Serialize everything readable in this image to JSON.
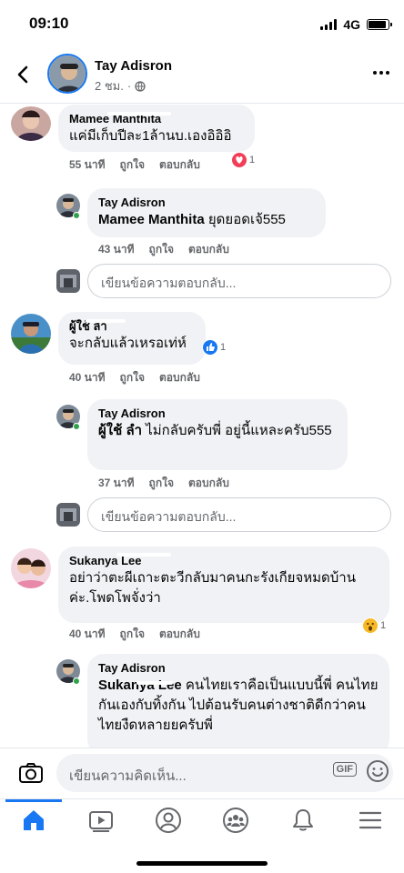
{
  "status_bar": {
    "time": "09:10",
    "network": "4G"
  },
  "header": {
    "name": "Tay Adisron",
    "time": "2 ชม."
  },
  "comments": [
    {
      "author": "Mamee Manthita",
      "text": "แค่มีเก็บปีละ1ล้านบ.เองอิอิอิ",
      "time": "55 นาที",
      "like": "ถูกใจ",
      "reply": "ตอบกลับ",
      "reaction": {
        "type": "love",
        "count": "1"
      },
      "replies": [
        {
          "author": "Tay Adisron",
          "tag": "Mamee Manthita",
          "text": "ยุดยอดเจ้555",
          "time": "43 นาที",
          "like": "ถูกใจ",
          "reply": "ตอบกลับ"
        }
      ],
      "reply_placeholder": "เขียนข้อความตอบกลับ..."
    },
    {
      "author": "ผู้ใช้ ลำ",
      "text": "จะกลับแล้วเหรอเท่ห์",
      "time": "40 นาที",
      "like": "ถูกใจ",
      "reply": "ตอบกลับ",
      "reaction": {
        "type": "like",
        "count": "1"
      },
      "replies": [
        {
          "author": "Tay Adisron",
          "tag": "ผู้ใช้ ลำ",
          "text": "ไม่กลับครับพี่ อยู่นี้แหละครับ555",
          "time": "37 นาที",
          "like": "ถูกใจ",
          "reply": "ตอบกลับ"
        }
      ],
      "reply_placeholder": "เขียนข้อความตอบกลับ..."
    },
    {
      "author": "Sukanya Lee",
      "text": "อย่าว่าตะผีเถาะตะวีกลับมาคนกะรังเกียจหมดบ้าน ค่ะ.โพดโพจั่งว่า",
      "time": "40 นาที",
      "like": "ถูกใจ",
      "reply": "ตอบกลับ",
      "reaction": {
        "type": "wow",
        "count": "1"
      },
      "replies": [
        {
          "author": "Tay Adisron",
          "tag": "Sukanya Lee",
          "text": "คนไทยเราคือเป็นแบบนี้พี่ คนไทยกันเองกับทิ้งกัน ไปต้อนรับคนต่างชาติดีกว่าคนไทยงืดหลายยครับพี่",
          "time": "",
          "like": "",
          "reply": ""
        }
      ]
    }
  ],
  "composer": {
    "placeholder": "เขียนความคิดเห็น...",
    "gif_label": "GIF"
  },
  "tabs": [
    "home-icon",
    "watch-icon",
    "profile-icon",
    "groups-icon",
    "notifications-icon",
    "menu-icon"
  ],
  "colors": {
    "accent": "#1877f2",
    "bubble": "#f0f2f5",
    "meta": "#65676b",
    "love": "#f33e58",
    "wow": "#f7b928"
  }
}
